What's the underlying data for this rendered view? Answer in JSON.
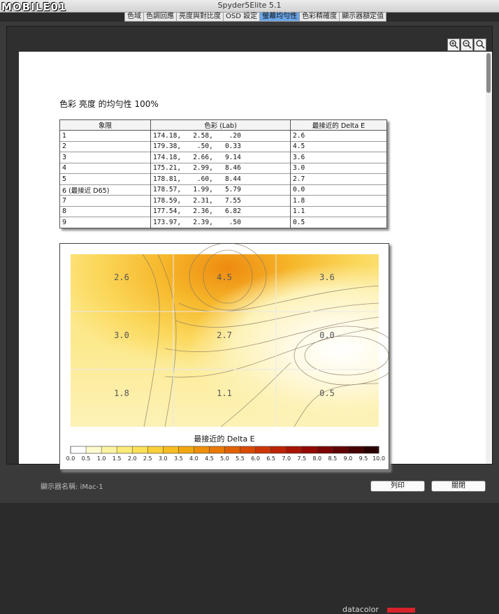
{
  "window": {
    "title": "Spyder5Elite 5.1",
    "logo": "MOBILE01"
  },
  "tabs": [
    {
      "label": "色域",
      "active": false
    },
    {
      "label": "色調回應",
      "active": false
    },
    {
      "label": "亮度與對比度",
      "active": false
    },
    {
      "label": "OSD 設定",
      "active": false
    },
    {
      "label": "螢幕均勻性",
      "active": true
    },
    {
      "label": "色彩精確度",
      "active": false
    },
    {
      "label": "顯示器額定值",
      "active": false
    }
  ],
  "zoom": {
    "in": "zoom-in-icon",
    "out": "zoom-out-icon",
    "fit": "magnify-icon"
  },
  "report": {
    "heading": "色彩 亮度 的均勻性 100%",
    "table": {
      "headers": [
        "象限",
        "色彩 (Lab)",
        "最接近的 Delta E"
      ],
      "rows": [
        {
          "q": "1",
          "lab": "174.18,   2.58,    .20",
          "de": "2.6"
        },
        {
          "q": "2",
          "lab": "179.38,    .50,   0.33",
          "de": "4.5"
        },
        {
          "q": "3",
          "lab": "174.18,   2.66,   9.14",
          "de": "3.6"
        },
        {
          "q": "4",
          "lab": "175.21,   2.99,   8.46",
          "de": "3.0"
        },
        {
          "q": "5",
          "lab": "178.81,    .60,   8.44",
          "de": "2.7"
        },
        {
          "q": "6 (最接近 D65)",
          "lab": "178.57,   1.99,   5.79",
          "de": "0.0"
        },
        {
          "q": "7",
          "lab": "178.59,   2.31,   7.55",
          "de": "1.8"
        },
        {
          "q": "8",
          "lab": "177.54,   2.36,   6.82",
          "de": "1.1"
        },
        {
          "q": "9",
          "lab": "173.97,   2.39,    .50",
          "de": "0.5"
        }
      ]
    },
    "chart": {
      "cells": [
        "2.6",
        "4.5",
        "3.6",
        "3.0",
        "2.7",
        "0.0",
        "1.8",
        "1.1",
        "0.5"
      ],
      "brand": "datacolor",
      "scale_title": "最接近的 Delta E",
      "scale_ticks": [
        "0.0",
        "0.5",
        "1.0",
        "1.5",
        "2.0",
        "2.5",
        "3.0",
        "3.5",
        "4.0",
        "4.5",
        "5.0",
        "5.5",
        "6.0",
        "6.5",
        "7.0",
        "7.5",
        "8.0",
        "8.5",
        "9.0",
        "9.5",
        "10.0"
      ],
      "scale_colors": [
        "#ffffff",
        "#fdfad0",
        "#fbf3a3",
        "#fbeb7a",
        "#fbe05a",
        "#f9d03a",
        "#f6bd22",
        "#f2a712",
        "#ee900c",
        "#e97a08",
        "#e16206",
        "#d84b05",
        "#cc3604",
        "#bc2303",
        "#a81403",
        "#920a03",
        "#7a0503",
        "#600303",
        "#460202",
        "#2a0101"
      ]
    }
  },
  "footer": {
    "display_name": "顯示器名稱: iMac-1",
    "print": "列印",
    "close": "關閉"
  }
}
